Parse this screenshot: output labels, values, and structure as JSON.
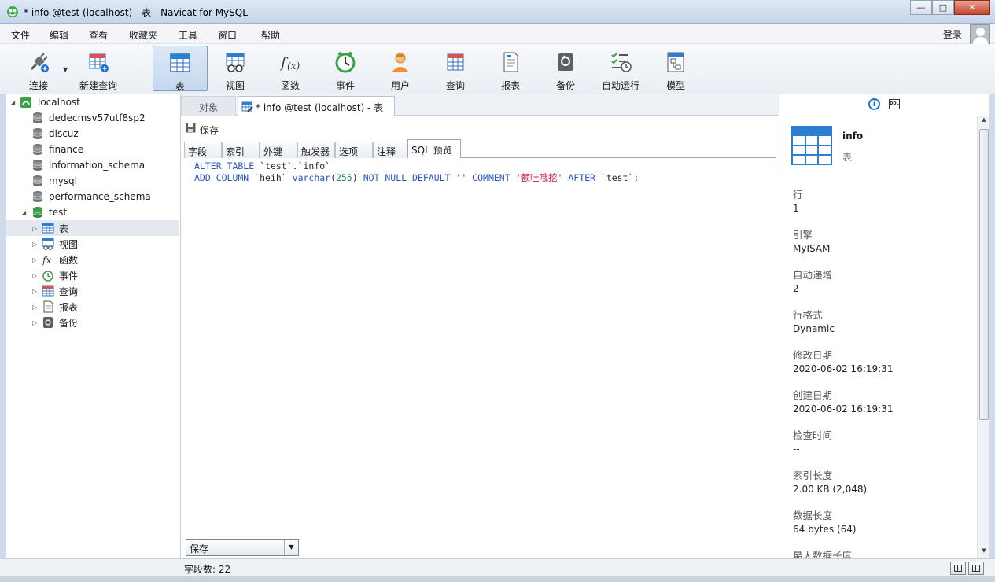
{
  "window": {
    "title": "* info @test (localhost) - 表 - Navicat for MySQL"
  },
  "menu": {
    "items": [
      "文件",
      "编辑",
      "查看",
      "收藏夹",
      "工具",
      "窗口",
      "帮助"
    ],
    "login": "登录"
  },
  "toolbar": {
    "connect": "连接",
    "new_query": "新建查询",
    "table": "表",
    "view": "视图",
    "function": "函数",
    "event": "事件",
    "user": "用户",
    "query": "查询",
    "report": "报表",
    "backup": "备份",
    "autorun": "自动运行",
    "model": "模型"
  },
  "tree": {
    "connection": "localhost",
    "databases": [
      "dedecmsv57utf8sp2",
      "discuz",
      "finance",
      "information_schema",
      "mysql",
      "performance_schema",
      "test"
    ],
    "objects": [
      "表",
      "视图",
      "函数",
      "事件",
      "查询",
      "报表",
      "备份"
    ]
  },
  "tabs": {
    "objects": "对象",
    "current": "* info @test (localhost) - 表"
  },
  "editor": {
    "save": "保存",
    "subtabs": [
      "字段",
      "索引",
      "外键",
      "触发器",
      "选项",
      "注释",
      "SQL 预览"
    ],
    "sql": {
      "l1_kw": "ALTER TABLE",
      "l1_rest": " `test`.`info`",
      "l2_kw1": "ADD COLUMN",
      "l2_col": " `heih` ",
      "l2_type": "varchar",
      "l2_p1": "(",
      "l2_num": "255",
      "l2_p2": ") ",
      "l2_kw2": "NOT NULL DEFAULT",
      "l2_def": " '' ",
      "l2_kw3": "COMMENT",
      "l2_comment": " '额哇哦挖'",
      "l2_kw4": " AFTER",
      "l2_end": " `test`;"
    },
    "mode_select": "保存"
  },
  "info": {
    "name": "info",
    "type": "表",
    "props": [
      {
        "label": "行",
        "value": "1"
      },
      {
        "label": "引擎",
        "value": "MyISAM"
      },
      {
        "label": "自动递增",
        "value": "2"
      },
      {
        "label": "行格式",
        "value": "Dynamic"
      },
      {
        "label": "修改日期",
        "value": "2020-06-02 16:19:31"
      },
      {
        "label": "创建日期",
        "value": "2020-06-02 16:19:31"
      },
      {
        "label": "检查时间",
        "value": "--"
      },
      {
        "label": "索引长度",
        "value": "2.00 KB (2,048)"
      },
      {
        "label": "数据长度",
        "value": "64 bytes (64)"
      },
      {
        "label": "最大数据长度",
        "value": ""
      }
    ]
  },
  "status": {
    "fields": "字段数: 22"
  },
  "colors": {
    "accent": "#1b74d1",
    "keyword": "#2a56c8",
    "string": "#c21a3f",
    "number": "#2a7f4f"
  }
}
